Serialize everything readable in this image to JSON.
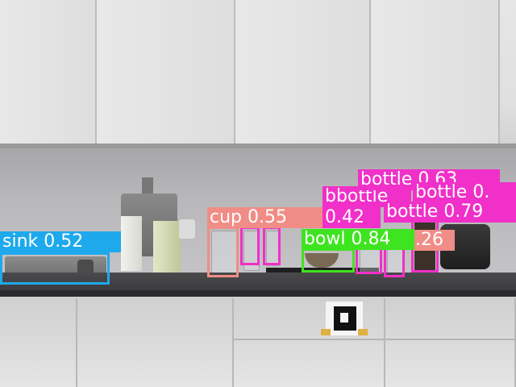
{
  "image": {
    "description_type": "kitchen counter photo with object detection overlays"
  },
  "detections": [
    {
      "label": "sink 0.52",
      "class": "sink",
      "color": "#1ea9ec"
    },
    {
      "label": "cup 0.55",
      "class": "cup",
      "color": "#f08d86"
    },
    {
      "label": "bowl 0.84",
      "class": "bowl",
      "color": "#3ee41f"
    },
    {
      "label": "bottle 0.63",
      "class": "bottle",
      "color": "#f030c8"
    },
    {
      "label": "bottle 0.79",
      "class": "bottle",
      "color": "#f030c8"
    },
    {
      "label": "bottle 0.",
      "class": "bottle",
      "color": "#f030c8"
    },
    {
      "label": "bbottle",
      "class": "bottle",
      "color": "#f030c8"
    },
    {
      "label": "0.42",
      "class": "bottle",
      "color": "#f030c8"
    },
    {
      "label": ".26",
      "class": "bottle",
      "color": "#f08d86"
    }
  ],
  "colors": {
    "sink": "#1ea9ec",
    "cup": "#f08d86",
    "bowl": "#3ee41f",
    "bottle": "#f030c8"
  }
}
